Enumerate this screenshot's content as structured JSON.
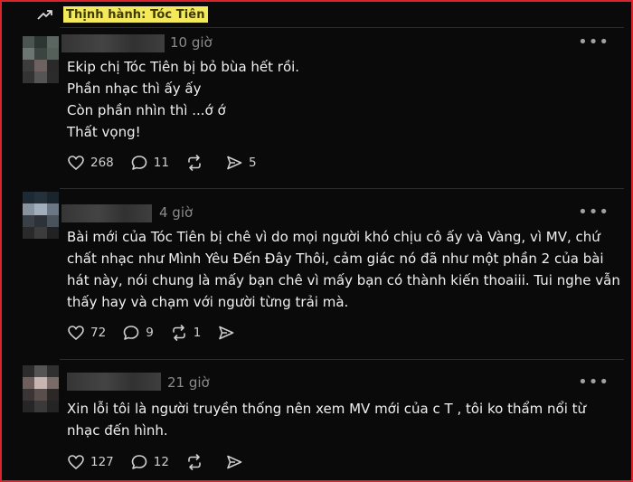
{
  "trending": {
    "label": "Thịnh hành: Tóc Tiên",
    "icon": "trending-up-icon"
  },
  "posts": [
    {
      "time": "10 giờ",
      "lines": [
        "Ekip chị Tóc Tiên bị bỏ bùa hết rồi.",
        "Phần nhạc thì ấy ấy",
        "Còn phần nhìn thì ...ớ ớ",
        "Thất vọng!"
      ],
      "likes": "268",
      "comments": "11",
      "reposts": "",
      "shares": "5"
    },
    {
      "time": "4 giờ",
      "lines": [
        "Bài mới của Tóc Tiên bị chê vì do mọi người khó chịu cô ấy và Vàng, vì MV, chứ",
        "chất nhạc như Mình Yêu Đến Đây Thôi, cảm giác nó đã như một phần 2 của bài",
        "hát này, nói chung là mấy bạn chê vì mấy bạn có thành kiến thoaiii. Tui nghe vẫn",
        "thấy hay và chạm với người từng trải mà."
      ],
      "likes": "72",
      "comments": "9",
      "reposts": "1",
      "shares": ""
    },
    {
      "time": "21 giờ",
      "lines": [
        "Xin lỗi tôi là người truyền thống nên xem MV mới của c T , tôi ko thẩm nổi từ",
        "nhạc đến hình."
      ],
      "likes": "127",
      "comments": "12",
      "reposts": "",
      "shares": ""
    }
  ],
  "more_label": "•••",
  "colors": {
    "frame": "#d9232d",
    "highlight": "#f4e95a",
    "background": "#0a0a0a"
  }
}
